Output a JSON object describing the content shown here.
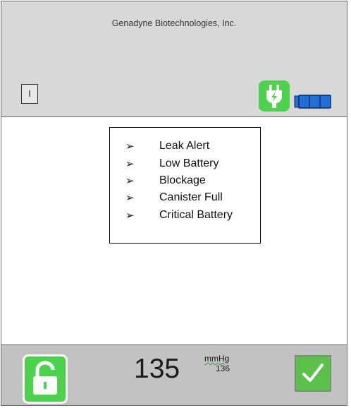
{
  "header": {
    "company": "Genadyne Biotechnologies, Inc.",
    "mode_button_label": "I",
    "power_icon": "plug-icon",
    "battery_icon": "battery-icon",
    "accent_color": "#4cd24c",
    "battery_color": "#1f6fd6"
  },
  "alerts": {
    "items": [
      "Leak Alert",
      "Low Battery",
      "Blockage",
      "Canister Full",
      "Critical Battery"
    ],
    "bullet": "➢"
  },
  "footer": {
    "lock_icon": "unlock-icon",
    "pressure_value": "135",
    "pressure_unit": "mmHg",
    "pressure_secondary": "136",
    "confirm_icon": "checkmark-icon"
  }
}
